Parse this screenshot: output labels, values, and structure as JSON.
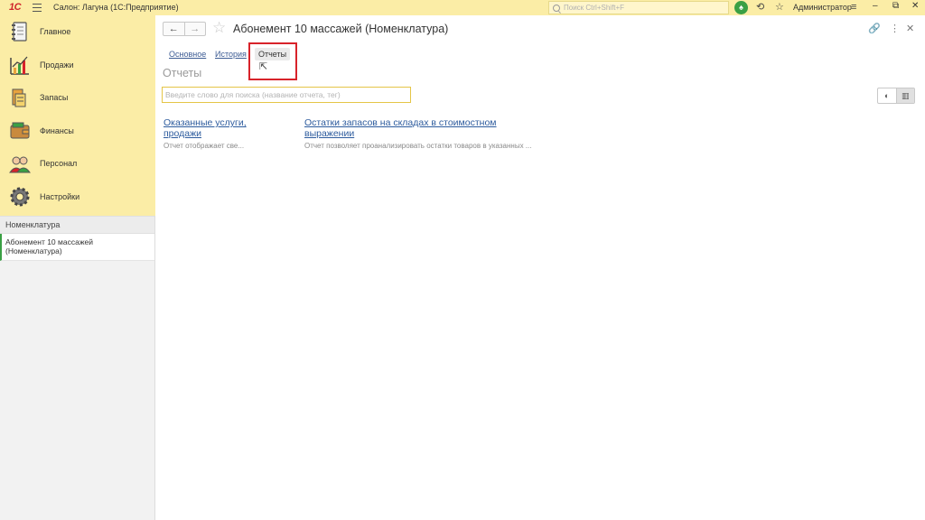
{
  "titlebar": {
    "logo_text": "1С",
    "app_title": "Салон: Лагуна  (1С:Предприятие)",
    "search_placeholder": "Поиск Ctrl+Shift+F",
    "user_name": "Администратор"
  },
  "sidebar": {
    "nav_items": [
      {
        "label": "Главное",
        "icon": "ledger-icon"
      },
      {
        "label": "Продажи",
        "icon": "sales-chart-icon"
      },
      {
        "label": "Запасы",
        "icon": "inventory-icon"
      },
      {
        "label": "Финансы",
        "icon": "wallet-icon"
      },
      {
        "label": "Персонал",
        "icon": "people-icon"
      },
      {
        "label": "Настройки",
        "icon": "gear-icon"
      }
    ],
    "section_header": "Номенклатура",
    "open_item_line1": "Абонемент 10 массажей",
    "open_item_line2": "(Номенклатура)"
  },
  "main": {
    "page_title": "Абонемент 10 массажей (Номенклатура)",
    "tabs": [
      {
        "label": "Основное"
      },
      {
        "label": "История"
      },
      {
        "label": "Отчеты",
        "active": true
      }
    ],
    "section_title": "Отчеты",
    "search_placeholder": "Введите слово для поиска (название отчета, тег)",
    "reports": [
      {
        "title_line1": "Оказанные услуги,",
        "title_line2": "продажи",
        "description": "Отчет отображает све..."
      },
      {
        "title_line1": "Остатки запасов на складах в стоимостном",
        "title_line2": "выражении",
        "description": "Отчет позволяет проанализировать остатки товаров в указанных ..."
      }
    ]
  },
  "colors": {
    "titlebar_bg": "#fbeda6",
    "highlight_border": "#d8232a",
    "link": "#2e5c9e",
    "notification_green": "#3aa044"
  }
}
